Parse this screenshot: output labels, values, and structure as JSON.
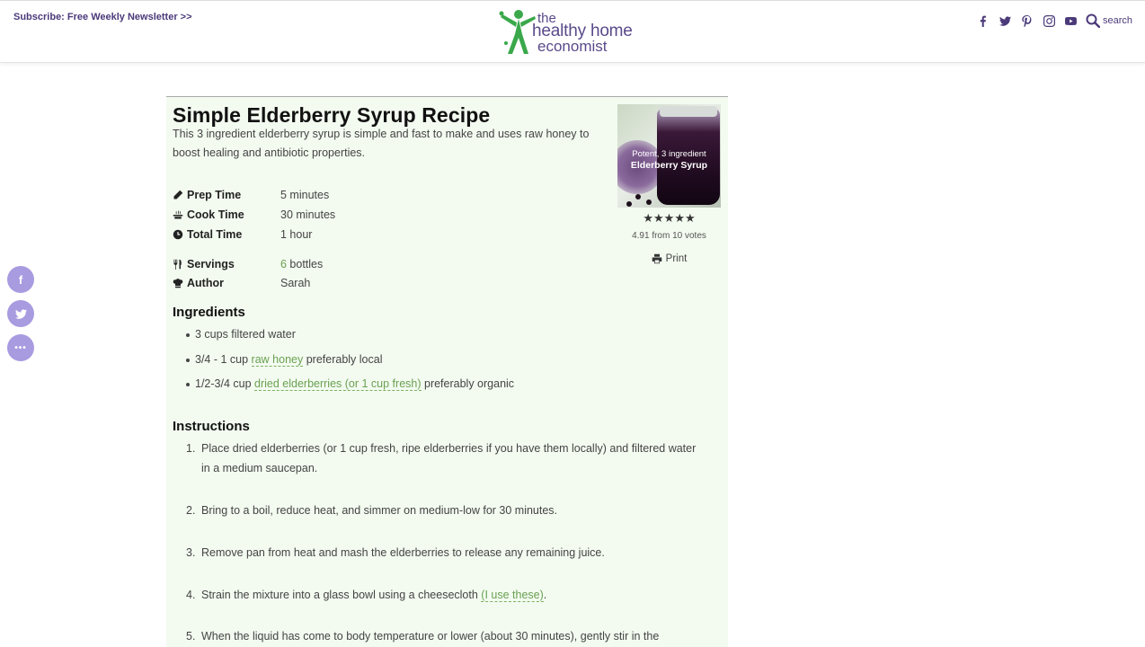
{
  "header": {
    "subscribe": "Subscribe: Free Weekly Newsletter >>",
    "logo": {
      "line1": "the",
      "line2": "healthy home",
      "line3": "economist"
    },
    "social_icons": [
      "facebook-icon",
      "twitter-icon",
      "pinterest-icon",
      "instagram-icon",
      "youtube-icon"
    ],
    "search_label": "search"
  },
  "side_share": [
    "facebook-icon",
    "twitter-icon",
    "more-icon"
  ],
  "recipe": {
    "title": "Simple Elderberry Syrup Recipe",
    "summary": "This 3 ingredient elderberry syrup is simple and fast to make and uses raw honey to boost healing and antibiotic properties.",
    "image": {
      "caption1": "Potent, 3 ingredient",
      "caption2": "Elderberry Syrup"
    },
    "rating": {
      "stars": 5,
      "text": "4.91 from 10 votes"
    },
    "print_label": "Print",
    "meta": [
      {
        "label": "Prep Time",
        "value": "5 minutes"
      },
      {
        "label": "Cook Time",
        "value": "30 minutes"
      },
      {
        "label": "Total Time",
        "value": "1 hour"
      },
      {
        "label": "Servings",
        "value_num": "6",
        "value_unit": " bottles"
      },
      {
        "label": "Author",
        "value": "Sarah"
      }
    ],
    "ingredients_heading": "Ingredients",
    "ingredients": [
      {
        "pre": "3 cups filtered water",
        "link": "",
        "post": ""
      },
      {
        "pre": "3/4 - 1 cup ",
        "link": "raw honey",
        "post": " preferably local"
      },
      {
        "pre": "1/2-3/4 cup ",
        "link": "dried elderberries (or 1 cup fresh)",
        "post": " preferably organic"
      }
    ],
    "instructions_heading": "Instructions",
    "instructions": [
      {
        "num": "1.",
        "pre": "Place dried elderberries (or 1 cup fresh, ripe elderberries if you have them locally) and filtered water in a medium saucepan.",
        "link": "",
        "post": ""
      },
      {
        "num": "2.",
        "pre": "Bring to a boil, reduce heat, and simmer on medium-low for 30 minutes.",
        "link": "",
        "post": ""
      },
      {
        "num": "3.",
        "pre": "Remove pan from heat and mash the elderberries to release any remaining juice.",
        "link": "",
        "post": ""
      },
      {
        "num": "4.",
        "pre": "Strain the mixture into a glass bowl using a cheesecloth ",
        "link": "(I use these)",
        "post": "."
      },
      {
        "num": "5.",
        "pre": "When the liquid has come to body  temperature or lower (about 30 minutes), gently stir in the",
        "link": "",
        "post": ""
      }
    ]
  },
  "colors": {
    "brand": "#4b3a7a",
    "accent_green": "#6aa052",
    "card_bg": "#f3fbf0",
    "share_bg": "#a99be0"
  }
}
